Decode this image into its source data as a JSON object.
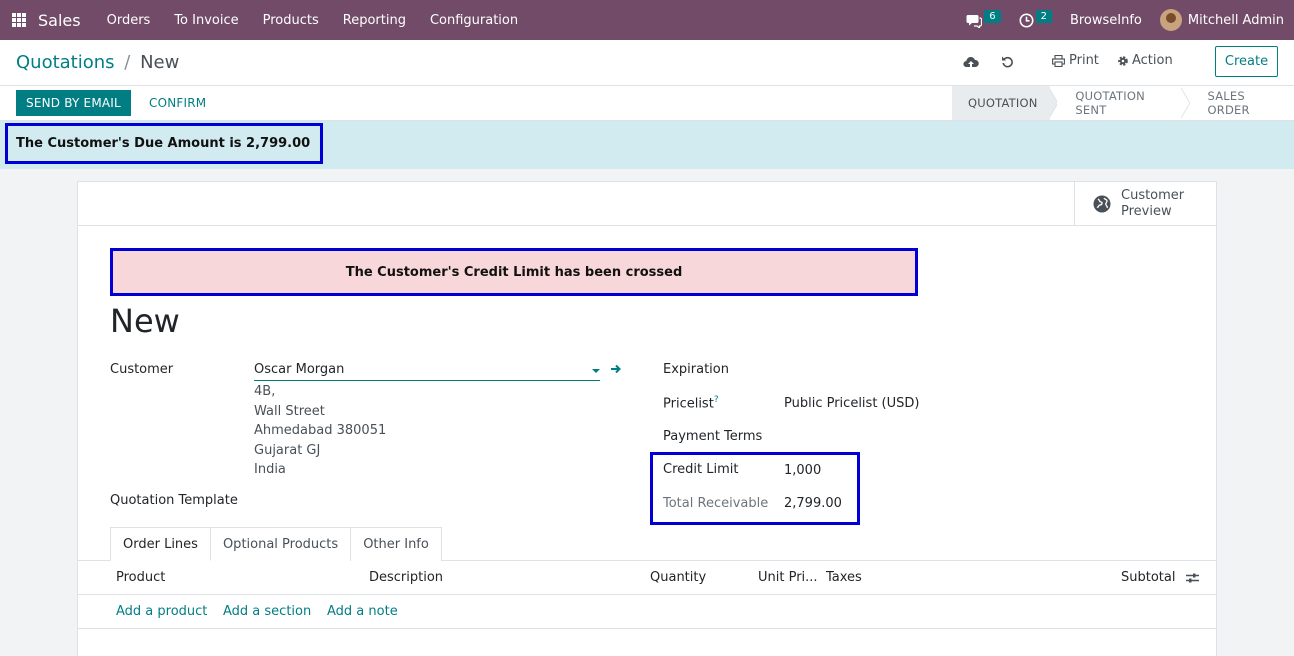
{
  "navbar": {
    "app_name": "Sales",
    "menu": [
      "Orders",
      "To Invoice",
      "Products",
      "Reporting",
      "Configuration"
    ],
    "messages_count": "6",
    "activities_count": "2",
    "company": "BrowseInfo",
    "user": "Mitchell Admin",
    "icons": [
      "apps-grid-icon",
      "chat-icon",
      "clock-icon",
      "avatar"
    ]
  },
  "breadcrumb": {
    "parent": "Quotations",
    "separator": "/",
    "current": "New"
  },
  "control": {
    "print_label": "Print",
    "action_label": "Action",
    "create_label": "Create",
    "icons": [
      "cloud-upload-icon",
      "undo-icon",
      "print-icon",
      "gear-icon"
    ]
  },
  "status_bar": {
    "send_email_label": "SEND BY EMAIL",
    "confirm_label": "CONFIRM",
    "stages": [
      "QUOTATION",
      "QUOTATION SENT",
      "SALES ORDER"
    ],
    "active_stage": "QUOTATION"
  },
  "due_banner": {
    "text": "The Customer's Due Amount is 2,799.00"
  },
  "sheet": {
    "customer_preview_line1": "Customer",
    "customer_preview_line2": "Preview",
    "credit_alert": "The Customer's Credit Limit has been crossed",
    "title": "New",
    "customer_label": "Customer",
    "customer_value": "Oscar Morgan",
    "address": [
      "4B,",
      "Wall Street",
      "Ahmedabad 380051",
      "Gujarat GJ",
      "India"
    ],
    "quotation_template_label": "Quotation Template",
    "expiration_label": "Expiration",
    "pricelist_label": "Pricelist",
    "pricelist_help": "?",
    "pricelist_value": "Public Pricelist (USD)",
    "payment_terms_label": "Payment Terms",
    "credit_limit_label": "Credit Limit",
    "credit_limit_value": "1,000",
    "total_receivable_label": "Total Receivable",
    "total_receivable_value": "2,799.00"
  },
  "tabs": [
    "Order Lines",
    "Optional Products",
    "Other Info"
  ],
  "table": {
    "columns": [
      "Product",
      "Description",
      "Quantity",
      "Unit Pri...",
      "Taxes",
      "Subtotal"
    ],
    "add_links": [
      "Add a product",
      "Add a section",
      "Add a note"
    ]
  },
  "colors": {
    "navbar": "#714b67",
    "primary": "#017e84",
    "highlight_border": "#0000d6",
    "info_banner": "#d2ebf0",
    "danger_alert": "#f8d7da"
  }
}
